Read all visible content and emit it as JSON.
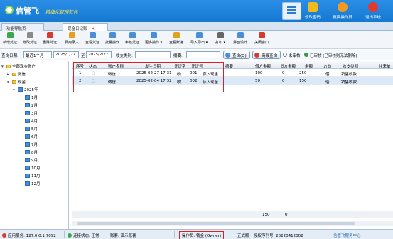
{
  "header": {
    "logo": "信管飞",
    "subtitle": "精细化管理软件",
    "buttons": [
      {
        "label": "修改密码",
        "icon": "lock-icon",
        "color": "#f5b91d"
      },
      {
        "label": "更换操作员",
        "icon": "user-icon",
        "color": "#f39a1e"
      },
      {
        "label": "退出系统",
        "icon": "close-icon",
        "color": "#e23b2e"
      }
    ]
  },
  "tabs": [
    {
      "label": "功能导航页"
    },
    {
      "label": "现金日记账",
      "close": "✕"
    }
  ],
  "toolbar": [
    {
      "label": "新增凭证",
      "icon": "add-icon",
      "color": "#3aa84a"
    },
    {
      "label": "修改凭证",
      "icon": "edit-icon",
      "color": "#8a8a8a"
    },
    {
      "label": "删除凭证",
      "icon": "delete-icon",
      "color": "#d83a2e"
    },
    {
      "label": "费用录入",
      "icon": "expense-icon",
      "color": "#e6a020"
    },
    {
      "label": "查看凭证",
      "icon": "view-icon",
      "color": "#4a8fd6"
    },
    {
      "label": "批量操作",
      "icon": "batch-icon",
      "color": "#4a8fd6"
    },
    {
      "label": "审核凭证",
      "icon": "audit-icon",
      "color": "#4a8fd6"
    },
    {
      "label": "更多操作 ▾",
      "icon": "more-icon",
      "color": "#4a8fd6"
    },
    {
      "label": "查看账簿",
      "icon": "ledger-icon",
      "color": "#e6a020"
    },
    {
      "label": "导入导出 ▾",
      "icon": "import-export-icon",
      "color": "#4a8fd6"
    },
    {
      "label": "打印 ▾",
      "icon": "print-icon",
      "color": "#666666"
    },
    {
      "label": "界面设计",
      "icon": "design-icon",
      "color": "#4a8fd6"
    },
    {
      "label": "关闭窗口",
      "icon": "close-window-icon",
      "color": "#d83a2e"
    }
  ],
  "query": {
    "date_label": "查询日期:",
    "date_range": "最近1个月",
    "date_from": "2025/1/27",
    "to_label": "至",
    "date_to": "2025/2/27",
    "category_label": "收支类别:",
    "category_value": "",
    "summary_label": "摘要:",
    "summary_value": "",
    "query_btn": "查询(Q)",
    "advanced_btn": "高级查询",
    "unaudited_label": "未审核",
    "audited_label": "已审核 (已审核则无法删除)"
  },
  "tree": {
    "root": "全部现金账户",
    "nodes": [
      "微信",
      "现金"
    ],
    "year": "2025年",
    "months": [
      "1月",
      "2月",
      "3月",
      "4月",
      "5月",
      "6月",
      "7月",
      "8月",
      "9月",
      "10月",
      "11月",
      "12月"
    ]
  },
  "grid": {
    "columns": [
      "序号",
      "状态",
      "账户名称",
      "发生日期",
      "凭证字",
      "凭证号",
      "摘要",
      "借方金额",
      "贷方金额",
      "余额",
      "方向",
      "收支类别",
      "往来单"
    ],
    "rows": [
      {
        "no": "1",
        "status": "○",
        "account": "微信",
        "date": "2025-02-27 17:31",
        "word": "收",
        "number": "001",
        "summary": "存入现金",
        "debit": "100",
        "credit": "0",
        "balance": "250",
        "direction": "借",
        "category": "销售收款"
      },
      {
        "no": "2",
        "status": "○",
        "account": "微信",
        "date": "2025-02-04 17:32",
        "word": "收",
        "number": "002",
        "summary": "存入现金",
        "debit": "50",
        "credit": "0",
        "balance": "150",
        "direction": "借",
        "category": "销售收款"
      }
    ],
    "footer": {
      "debit_total": "150",
      "credit_total": "0"
    }
  },
  "status": {
    "app_server": "应用服务:",
    "app_server_value": "127.0.0.1:7092",
    "conn_label": "连接状态:",
    "conn_value": "正常",
    "account_set": "账套: 演示账套",
    "operator": "操作员: 钱金 (Owner)",
    "edition": "正式版",
    "license": "授权序列号: 20220412002",
    "help": "信管飞服务中心"
  }
}
